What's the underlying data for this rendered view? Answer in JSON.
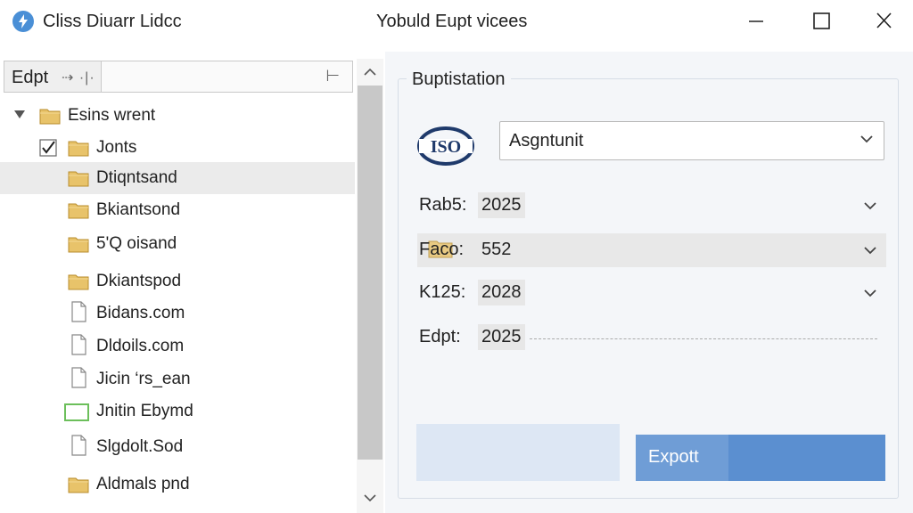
{
  "titlebar": {
    "app_title": "Cliss Diuarr Lidcc",
    "window_title": "Yobuld Eupt vicees"
  },
  "left_panel": {
    "toolbar": {
      "edit_label": "Edpt",
      "tool_glyph": "⇢ ·|·",
      "right_glyph": "⊢"
    },
    "tree": [
      {
        "label": "Esins wrent",
        "icon": "folder-icon",
        "expanded": true,
        "checked": false,
        "indent": 0
      },
      {
        "label": "Jonts",
        "icon": "folder-icon",
        "expanded": false,
        "checked": true,
        "indent": 1
      },
      {
        "label": "Dtiqntsand",
        "icon": "folder-icon",
        "expanded": false,
        "checked": false,
        "indent": 2,
        "selected": true
      },
      {
        "label": "Bkiantsond",
        "icon": "folder-icon",
        "expanded": false,
        "checked": false,
        "indent": 2
      },
      {
        "label": "5'Q oisand",
        "icon": "folder-icon",
        "expanded": false,
        "checked": false,
        "indent": 2
      },
      {
        "label": "Dkiantspod",
        "icon": "folder-icon",
        "expanded": false,
        "checked": false,
        "indent": 2
      },
      {
        "label": "Bidans.com",
        "icon": "file-icon",
        "expanded": false,
        "checked": false,
        "indent": 2
      },
      {
        "label": "Dldoils.com",
        "icon": "file-icon",
        "expanded": false,
        "checked": false,
        "indent": 2
      },
      {
        "label": "Jicin ‘rs_ean",
        "icon": "file-icon",
        "expanded": false,
        "checked": false,
        "indent": 2
      },
      {
        "label": "Jnitin Ebymd",
        "icon": "green-file-icon",
        "expanded": false,
        "checked": false,
        "indent": 2
      },
      {
        "label": "Slgdolt.Sod",
        "icon": "file-icon",
        "expanded": false,
        "checked": false,
        "indent": 2
      },
      {
        "label": "Aldmals pnd",
        "icon": "folder-icon",
        "expanded": false,
        "checked": false,
        "indent": 2
      }
    ]
  },
  "right_panel": {
    "group_title": "Buptistation",
    "iso_logo_text": "ISO",
    "select": {
      "value": "Asgntunit"
    },
    "fields": [
      {
        "key": "Rab5:",
        "value": "2025",
        "chevron": true,
        "highlighted": false
      },
      {
        "key": "Faco:",
        "value": "552",
        "chevron": true,
        "highlighted": true
      },
      {
        "key": "K125:",
        "value": "2028",
        "chevron": true,
        "highlighted": false
      },
      {
        "key": "Edpt:",
        "value": "2025",
        "chevron": false,
        "highlighted": false
      }
    ],
    "export_label": "Expott"
  },
  "colors": {
    "accent": "#5b8fd0",
    "panel_bg": "#f4f6f9",
    "selection": "#ebebeb",
    "folder": "#e8c36a"
  }
}
